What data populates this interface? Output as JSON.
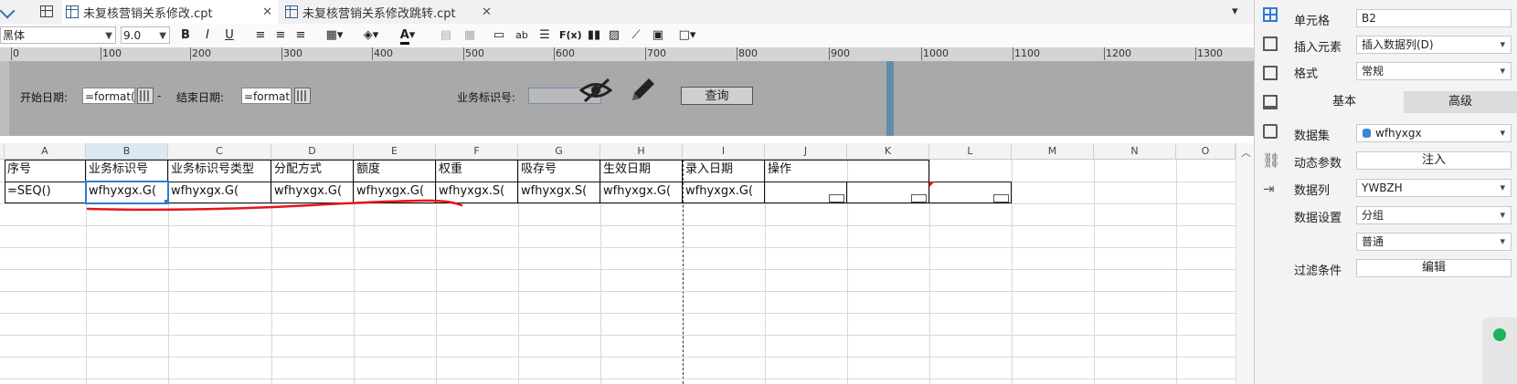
{
  "tabs": [
    {
      "label": "未复核营销关系修改.cpt",
      "active": true
    },
    {
      "label": "未复核营销关系修改跳转.cpt",
      "active": false
    }
  ],
  "toolbar": {
    "font_family": "黑体",
    "font_size": "9.0",
    "bold": "B",
    "italic": "I",
    "underline": "U",
    "font_color_glyph": "A",
    "text_ab": "ab",
    "formula_glyph": "F(x)"
  },
  "ruler": {
    "ticks": [
      "0",
      "100",
      "200",
      "300",
      "400",
      "500",
      "600",
      "700",
      "800",
      "900",
      "1000",
      "1100",
      "1200",
      "1300"
    ]
  },
  "params": {
    "start_date_label": "开始日期:",
    "start_date_value": "=format(t",
    "dash": "-",
    "end_date_label": "结束日期:",
    "end_date_value": "=format(t",
    "business_id_label": "业务标识号:",
    "business_id_value": "",
    "query_button": "查询"
  },
  "grid": {
    "columns": [
      "A",
      "B",
      "C",
      "D",
      "E",
      "F",
      "G",
      "H",
      "I",
      "J",
      "K",
      "L",
      "M",
      "N",
      "O"
    ],
    "header_row": [
      "序号",
      "业务标识号",
      "业务标识号类型",
      "分配方式",
      "额度",
      "权重",
      "吸存号",
      "生效日期",
      "录入日期",
      "操作",
      "",
      ""
    ],
    "data_row": [
      "=SEQ()",
      "wfhyxgx.G(",
      "wfhyxgx.G(",
      "wfhyxgx.G(",
      "wfhyxgx.G(",
      "wfhyxgx.S(",
      "wfhyxgx.S(",
      "wfhyxgx.G(",
      "wfhyxgx.G(",
      "",
      "",
      ""
    ],
    "selected_cell": "B2"
  },
  "properties": {
    "cell_label": "单元格",
    "cell_value": "B2",
    "insert_label": "插入元素",
    "insert_value": "插入数据列(D)",
    "format_label": "格式",
    "format_value": "常规",
    "tab_basic": "基本",
    "tab_advanced": "高级",
    "dataset_label": "数据集",
    "dataset_value": "wfhyxgx",
    "dynamic_param_label": "动态参数",
    "dynamic_param_button": "注入",
    "data_column_label": "数据列",
    "data_column_value": "YWBZH",
    "data_setting_label": "数据设置",
    "data_setting_value": "分组",
    "data_setting_mode": "普通",
    "filter_label": "过滤条件",
    "filter_button": "编辑"
  },
  "colors": {
    "param_bg": "#a9a9a9",
    "selection": "#2f7ad6",
    "annotation_red": "#e8141c",
    "status_green": "#1fb45a"
  }
}
